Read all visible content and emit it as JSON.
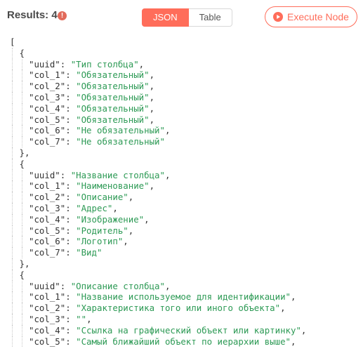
{
  "toolbar": {
    "results_label": "Results: 4",
    "info_icon": "!",
    "tabs": [
      {
        "label": "JSON",
        "active": true
      },
      {
        "label": "Table",
        "active": false
      }
    ],
    "execute_label": "Execute Node"
  },
  "colors": {
    "accent": "#ff6d5a",
    "string": "#2d9a55",
    "key": "#333333",
    "info": "#e26a5a"
  },
  "json_lines": [
    {
      "indent": 0,
      "text": "["
    },
    {
      "indent": 1,
      "text": "{"
    },
    {
      "indent": 2,
      "key": "\"uuid\"",
      "value": "\"Тип столбца\"",
      "comma": ","
    },
    {
      "indent": 2,
      "key": "\"col_1\"",
      "value": "\"Обязательный\"",
      "comma": ","
    },
    {
      "indent": 2,
      "key": "\"col_2\"",
      "value": "\"Обязательный\"",
      "comma": ","
    },
    {
      "indent": 2,
      "key": "\"col_3\"",
      "value": "\"Обязательный\"",
      "comma": ","
    },
    {
      "indent": 2,
      "key": "\"col_4\"",
      "value": "\"Обязательный\"",
      "comma": ","
    },
    {
      "indent": 2,
      "key": "\"col_5\"",
      "value": "\"Обязательный\"",
      "comma": ","
    },
    {
      "indent": 2,
      "key": "\"col_6\"",
      "value": "\"Не обязательный\"",
      "comma": ","
    },
    {
      "indent": 2,
      "key": "\"col_7\"",
      "value": "\"Не обязательный\"",
      "comma": ""
    },
    {
      "indent": 1,
      "text": "},"
    },
    {
      "indent": 1,
      "text": "{"
    },
    {
      "indent": 2,
      "key": "\"uuid\"",
      "value": "\"Название столбца\"",
      "comma": ","
    },
    {
      "indent": 2,
      "key": "\"col_1\"",
      "value": "\"Наименование\"",
      "comma": ","
    },
    {
      "indent": 2,
      "key": "\"col_2\"",
      "value": "\"Описание\"",
      "comma": ","
    },
    {
      "indent": 2,
      "key": "\"col_3\"",
      "value": "\"Адрес\"",
      "comma": ","
    },
    {
      "indent": 2,
      "key": "\"col_4\"",
      "value": "\"Изображение\"",
      "comma": ","
    },
    {
      "indent": 2,
      "key": "\"col_5\"",
      "value": "\"Родитель\"",
      "comma": ","
    },
    {
      "indent": 2,
      "key": "\"col_6\"",
      "value": "\"Логотип\"",
      "comma": ","
    },
    {
      "indent": 2,
      "key": "\"col_7\"",
      "value": "\"Вид\"",
      "comma": ""
    },
    {
      "indent": 1,
      "text": "},"
    },
    {
      "indent": 1,
      "text": "{"
    },
    {
      "indent": 2,
      "key": "\"uuid\"",
      "value": "\"Описание столбца\"",
      "comma": ","
    },
    {
      "indent": 2,
      "key": "\"col_1\"",
      "value": "\"Название используемое для идентификации\"",
      "comma": ","
    },
    {
      "indent": 2,
      "key": "\"col_2\"",
      "value": "\"Характеристика того или иного объекта\"",
      "comma": ","
    },
    {
      "indent": 2,
      "key": "\"col_3\"",
      "value": "\"\"",
      "comma": ","
    },
    {
      "indent": 2,
      "key": "\"col_4\"",
      "value": "\"Ссылка на графический объект или картинку\"",
      "comma": ","
    },
    {
      "indent": 2,
      "key": "\"col_5\"",
      "value": "\"Самый ближайший объект по иерархии выше\"",
      "comma": ","
    }
  ]
}
